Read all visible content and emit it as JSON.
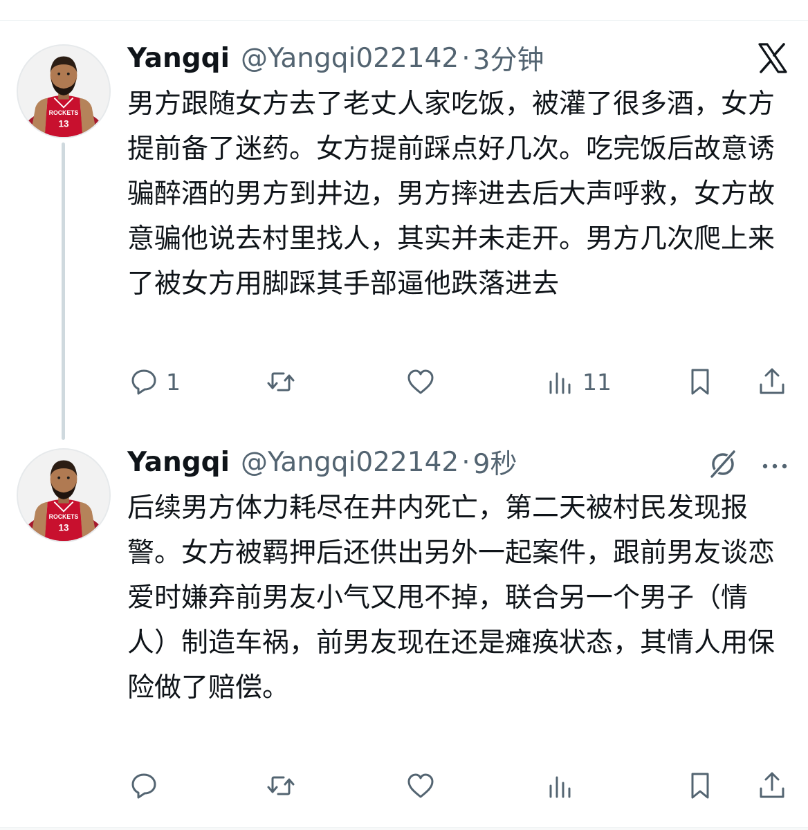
{
  "colors": {
    "text": "#0f1419",
    "muted": "#536471",
    "thread_line": "#cfd9de",
    "jersey_red": "#c8102e"
  },
  "icons": {
    "reply": "speech-bubble-icon",
    "retweet": "retweet-arrows-icon",
    "like": "heart-icon",
    "views": "bar-chart-icon",
    "bookmark": "bookmark-icon",
    "share": "share-upload-icon",
    "platform": "x-logo-icon",
    "grok": "grok-slash-icon",
    "more": "more-dots-icon"
  },
  "tweets": [
    {
      "author": {
        "name": "Yangqi",
        "handle": "@Yangqi022142",
        "jersey_team": "ROCKETS",
        "jersey_number": "13"
      },
      "separator": "·",
      "time": "3分钟",
      "text": "男方跟随女方去了老丈人家吃饭，被灌了很多酒，女方提前备了迷药。女方提前踩点好几次。吃完饭后故意诱骗醉酒的男方到井边，男方摔进去后大声呼救，女方故意骗他说去村里找人，其实并未走开。男方几次爬上来了被女方用脚踩其手部逼他跌落进去",
      "metrics": {
        "replies": "1",
        "retweets": "",
        "likes": "",
        "views": "11"
      }
    },
    {
      "author": {
        "name": "Yangqi",
        "handle": "@Yangqi022142",
        "jersey_team": "ROCKETS",
        "jersey_number": "13"
      },
      "separator": "·",
      "time": "9秒",
      "text": "后续男方体力耗尽在井内死亡，第二天被村民发现报警。女方被羁押后还供出另外一起案件，跟前男友谈恋爱时嫌弃前男友小气又甩不掉，联合另一个男子（情人）制造车祸，前男友现在还是瘫痪状态，其情人用保险做了赔偿。",
      "metrics": {
        "replies": "",
        "retweets": "",
        "likes": "",
        "views": ""
      }
    }
  ]
}
